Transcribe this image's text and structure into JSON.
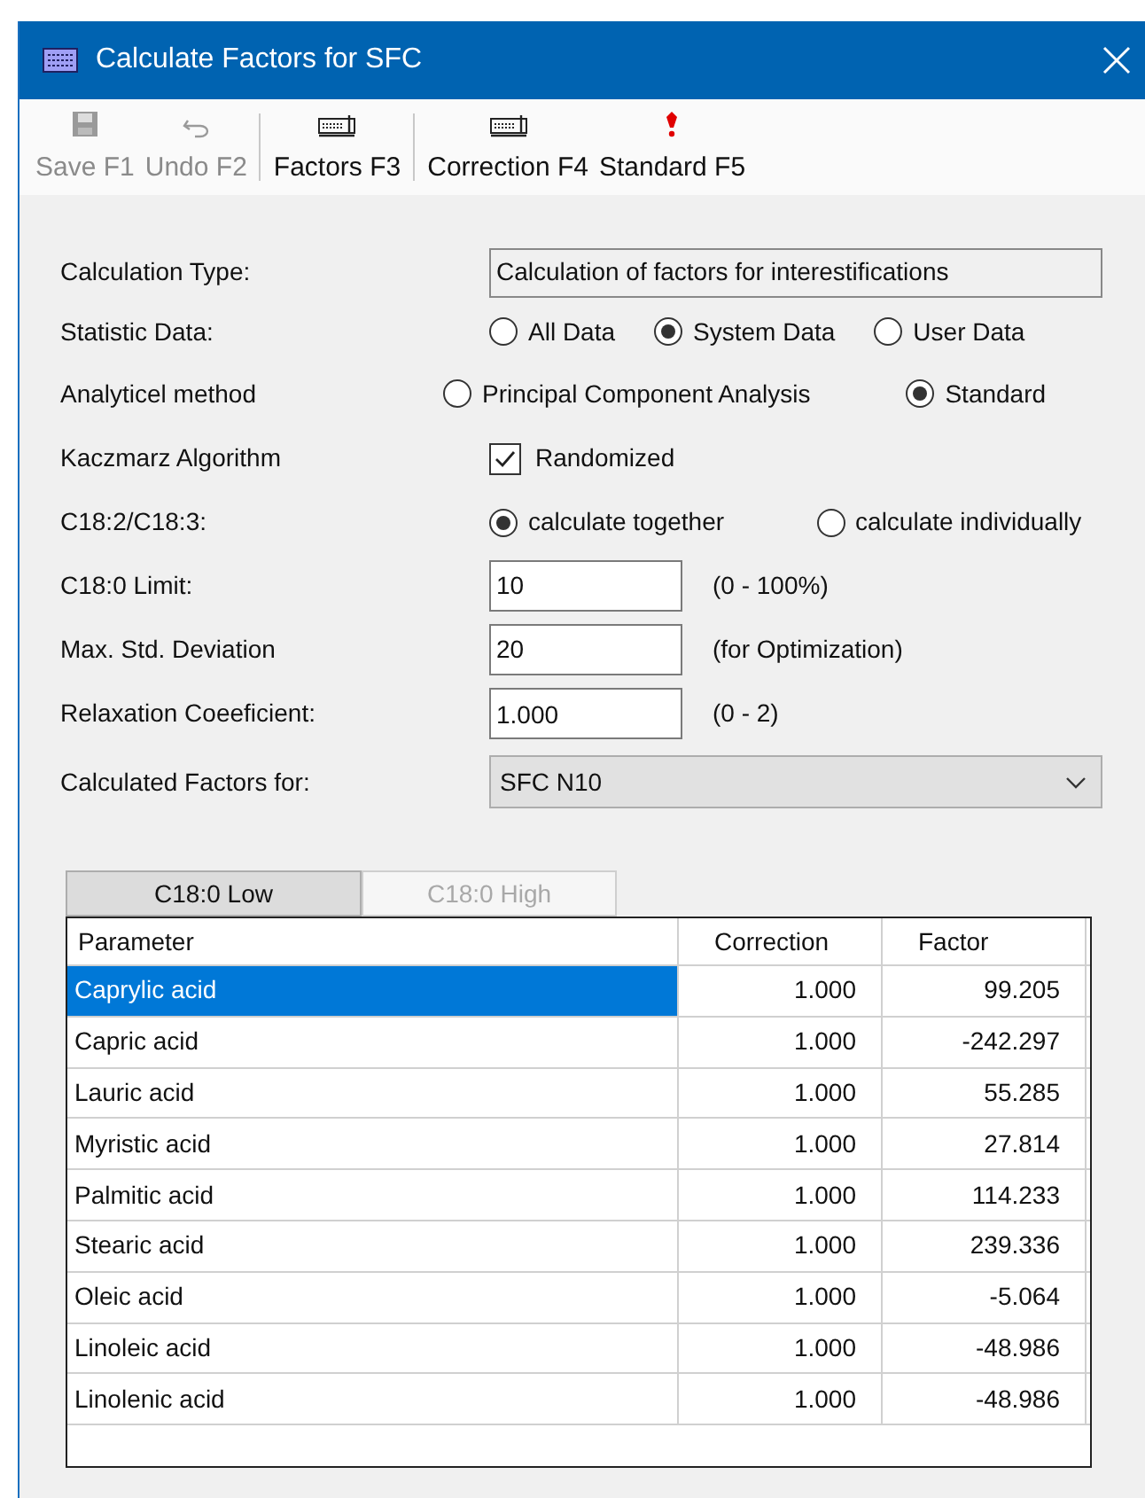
{
  "window": {
    "title": "Calculate Factors for SFC"
  },
  "toolbar": [
    {
      "label": "Save F1",
      "kind": "save",
      "disabled": true,
      "separated": false
    },
    {
      "label": "Undo F2",
      "kind": "undo",
      "disabled": true,
      "separated": false
    },
    {
      "label": "Factors F3",
      "kind": "grid",
      "disabled": false,
      "separated": true
    },
    {
      "label": "Correction F4",
      "kind": "grid",
      "disabled": false,
      "separated": true
    },
    {
      "label": "Standard F5",
      "kind": "alert",
      "disabled": false,
      "separated": false
    }
  ],
  "form": [
    {
      "kind": "readonly",
      "label": "Calculation Type:",
      "value": "Calculation of factors for interestifications"
    },
    {
      "kind": "radio",
      "label": "Statistic Data:",
      "options": [
        {
          "label": "All Data",
          "selected": false
        },
        {
          "label": "System Data",
          "selected": true
        },
        {
          "label": "User Data",
          "selected": false
        }
      ]
    },
    {
      "kind": "radio",
      "label": "Analyticel method",
      "options": [
        {
          "label": "Principal Component Analysis",
          "selected": false
        },
        {
          "label": "Standard",
          "selected": true
        }
      ]
    },
    {
      "kind": "checkbox",
      "label": "Kaczmarz Algorithm",
      "option": "Randomized",
      "checked": true
    },
    {
      "kind": "radio",
      "label": "C18:2/C18:3:",
      "options": [
        {
          "label": "calculate together",
          "selected": true
        },
        {
          "label": "calculate individually",
          "selected": false
        }
      ]
    },
    {
      "kind": "input",
      "label": "C18:0 Limit:",
      "value": "10",
      "hint": "(0 - 100%)"
    },
    {
      "kind": "input",
      "label": "Max. Std. Deviation",
      "value": "20",
      "hint": "(for Optimization)"
    },
    {
      "kind": "input",
      "label": "Relaxation Coeeficient:",
      "value": "1.000",
      "hint": "(0 - 2)"
    },
    {
      "kind": "select",
      "label": "Calculated Factors for:",
      "value": "SFC N10"
    }
  ],
  "tabs": [
    {
      "label": "C18:0 Low",
      "selected": true
    },
    {
      "label": "C18:0 High",
      "selected": false
    }
  ],
  "table": {
    "columns": [
      "Parameter",
      "Correction",
      "Factor"
    ],
    "rows": [
      {
        "cells": [
          "Caprylic acid",
          "1.000",
          "99.205"
        ],
        "selected": true
      },
      {
        "cells": [
          "Capric acid",
          "1.000",
          "-242.297"
        ],
        "selected": false
      },
      {
        "cells": [
          "Lauric acid",
          "1.000",
          "55.285"
        ],
        "selected": false
      },
      {
        "cells": [
          "Myristic acid",
          "1.000",
          "27.814"
        ],
        "selected": false
      },
      {
        "cells": [
          "Palmitic acid",
          "1.000",
          "114.233"
        ],
        "selected": false
      },
      {
        "cells": [
          "Stearic acid",
          "1.000",
          "239.336"
        ],
        "selected": false
      },
      {
        "cells": [
          "Oleic acid",
          "1.000",
          "-5.064"
        ],
        "selected": false
      },
      {
        "cells": [
          "Linoleic acid",
          "1.000",
          "-48.986"
        ],
        "selected": false
      },
      {
        "cells": [
          "Linolenic acid",
          "1.000",
          "-48.986"
        ],
        "selected": false
      }
    ]
  }
}
